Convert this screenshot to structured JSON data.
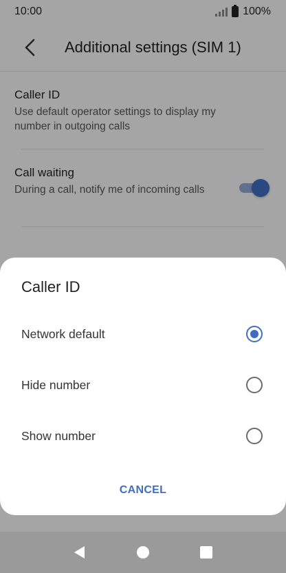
{
  "status_bar": {
    "time": "10:00",
    "battery_percent": "100%",
    "icons": [
      "signal-icon",
      "battery-icon"
    ]
  },
  "app_bar": {
    "back_icon": "back-arrow-icon",
    "title": "Additional settings (SIM 1)"
  },
  "settings": {
    "caller_id": {
      "title": "Caller ID",
      "description": "Use default operator settings to display my number in outgoing calls"
    },
    "call_waiting": {
      "title": "Call waiting",
      "description": "During a call, notify me of incoming calls",
      "enabled": true
    }
  },
  "dialog": {
    "title": "Caller ID",
    "options": [
      {
        "label": "Network default",
        "selected": true
      },
      {
        "label": "Hide number",
        "selected": false
      },
      {
        "label": "Show number",
        "selected": false
      }
    ],
    "cancel_label": "CANCEL"
  },
  "nav_bar": {
    "icons": [
      "back-triangle-icon",
      "home-circle-icon",
      "recents-square-icon"
    ]
  },
  "colors": {
    "accent": "#3f6ec0",
    "scrim": "rgba(0,0,0,0.33)",
    "nav_bar": "#9a9a9a"
  }
}
